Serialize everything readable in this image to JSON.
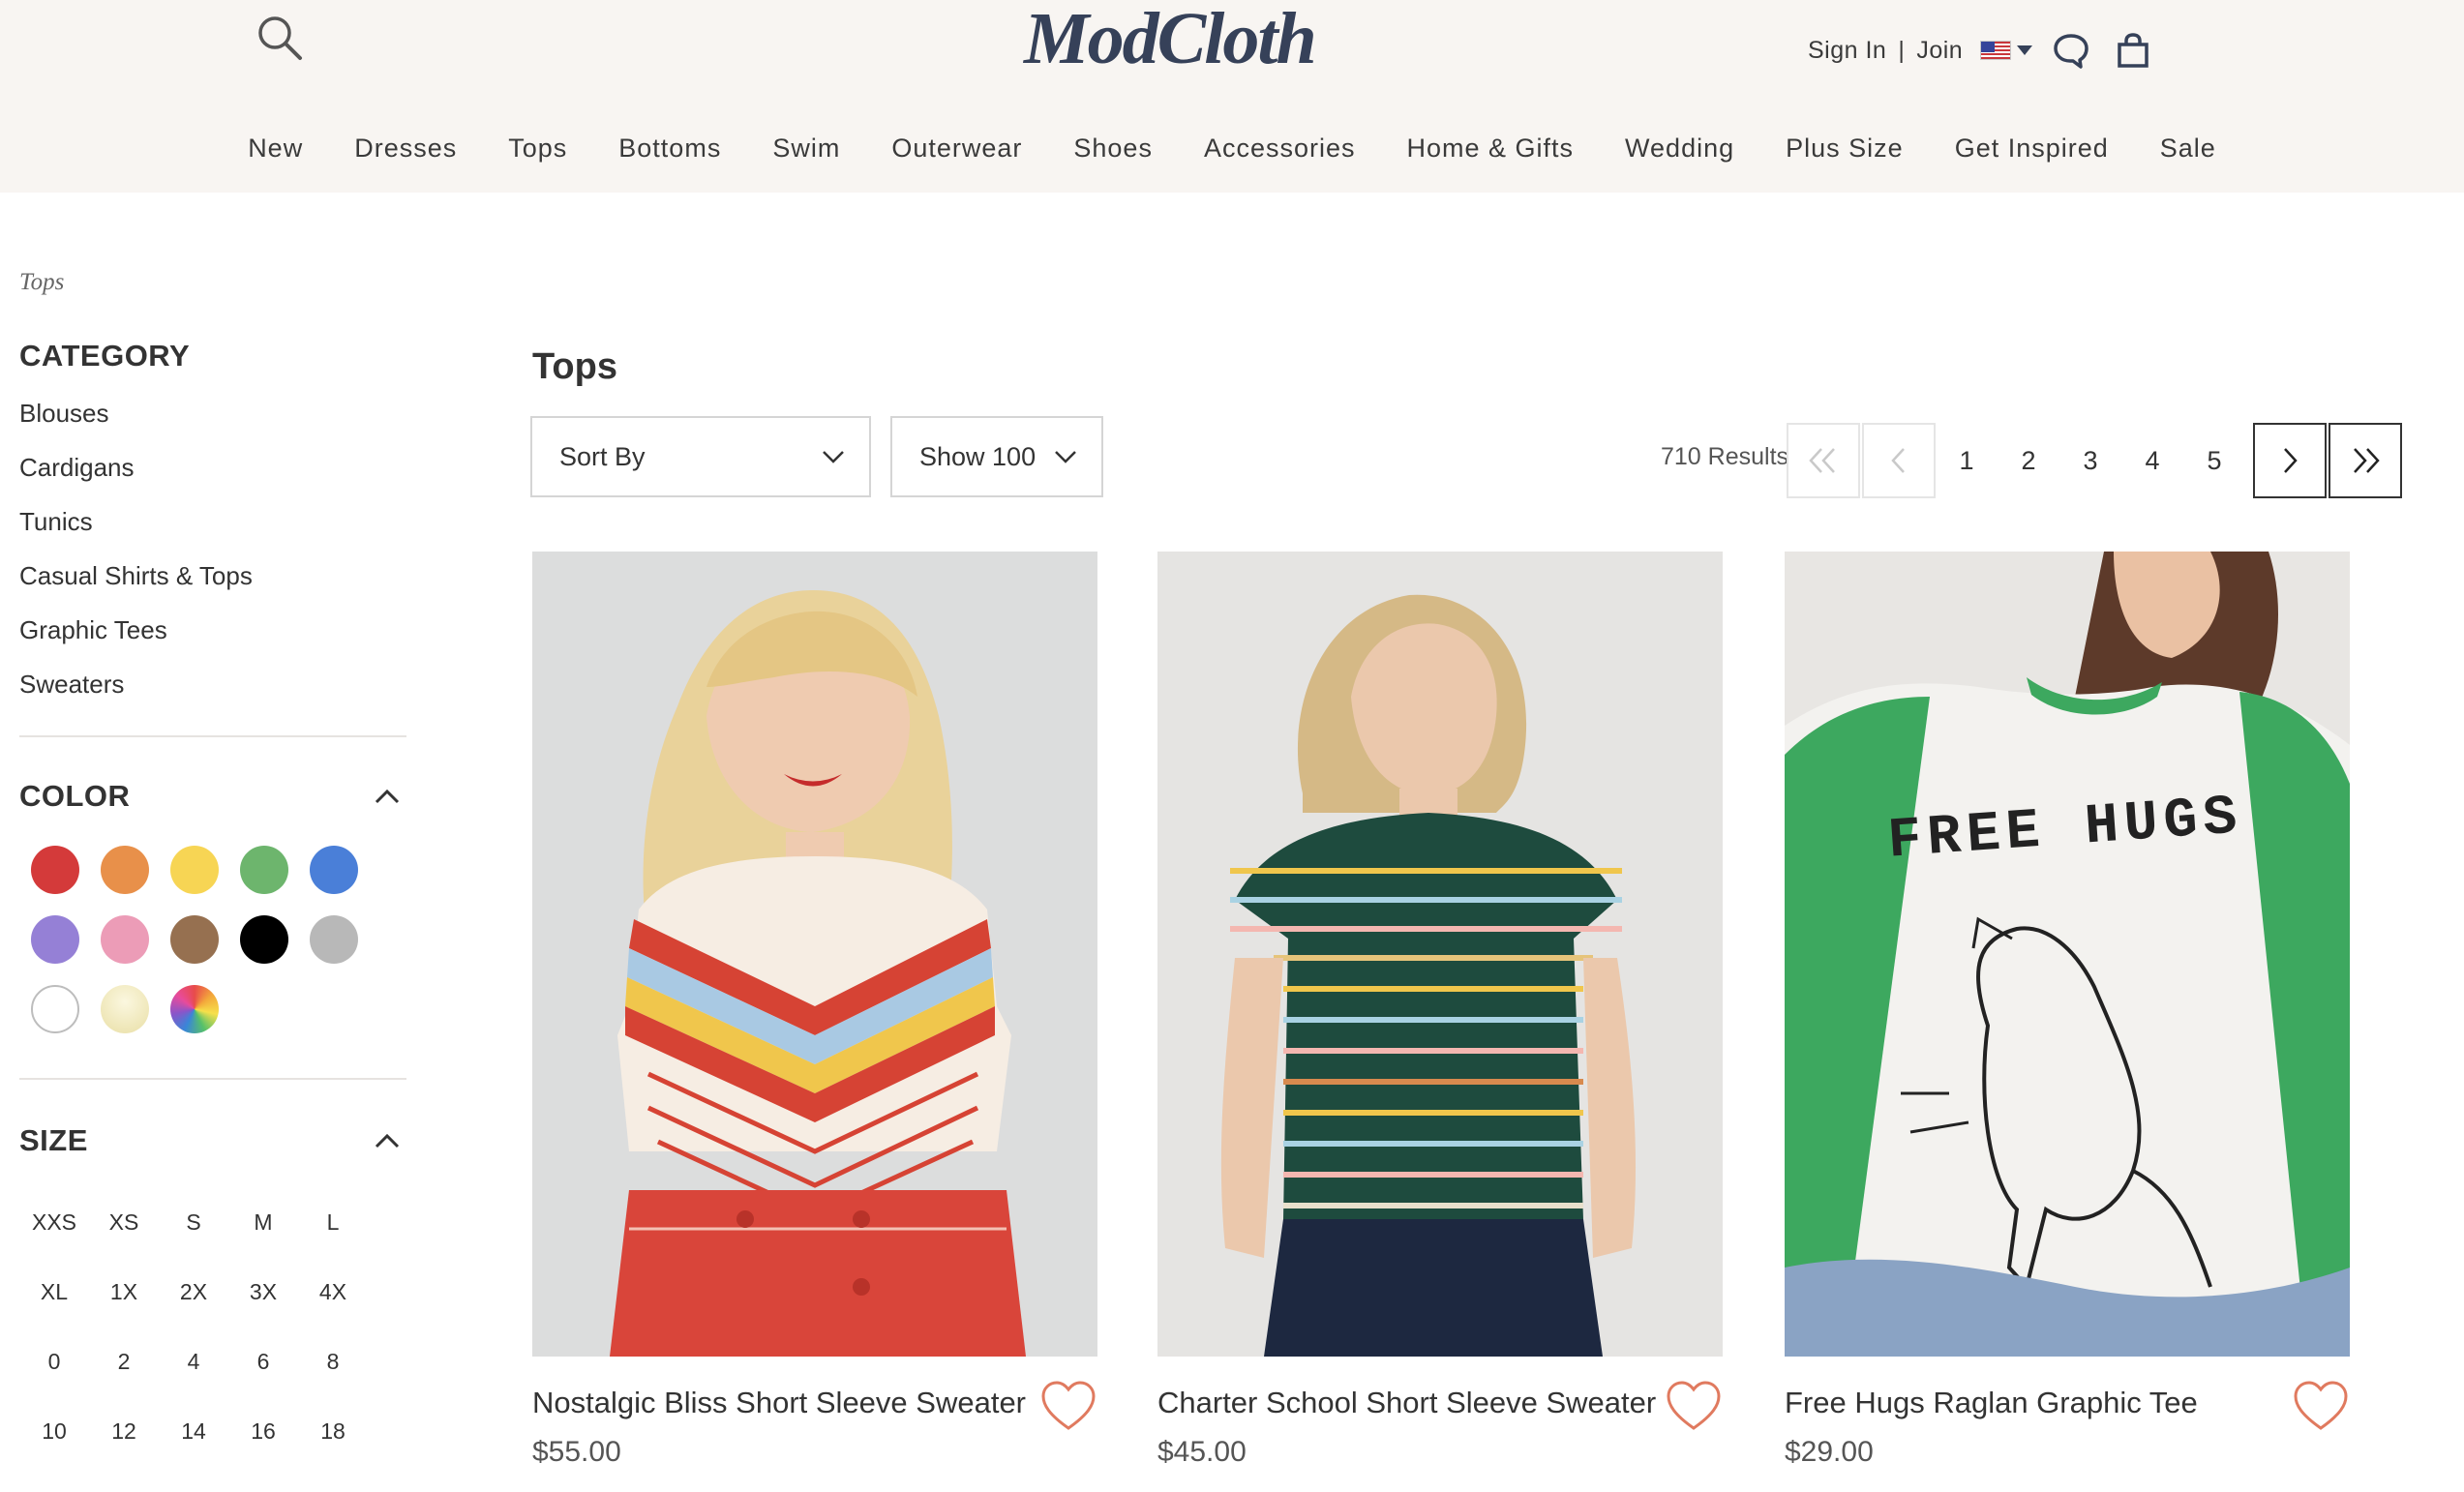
{
  "header": {
    "logo": "ModCloth",
    "sign_in": "Sign In",
    "separator": "|",
    "join": "Join"
  },
  "nav": [
    "New",
    "Dresses",
    "Tops",
    "Bottoms",
    "Swim",
    "Outerwear",
    "Shoes",
    "Accessories",
    "Home & Gifts",
    "Wedding",
    "Plus Size",
    "Get Inspired",
    "Sale"
  ],
  "breadcrumb": "Tops",
  "sidebar": {
    "category_title": "CATEGORY",
    "categories": [
      "Blouses",
      "Cardigans",
      "Tunics",
      "Casual Shirts & Tops",
      "Graphic Tees",
      "Sweaters"
    ],
    "color_title": "COLOR",
    "colors": [
      "#d43a3a",
      "#e8904a",
      "#f7d554",
      "#6db56d",
      "#4a7fd8",
      "#9580d6",
      "#ec9cb7",
      "#967050",
      "#000000",
      "#b8b8b8",
      "#ffffff",
      "#f2ebc3",
      "multicolor"
    ],
    "size_title": "SIZE",
    "sizes": [
      "XXS",
      "XS",
      "S",
      "M",
      "L",
      "XL",
      "1X",
      "2X",
      "3X",
      "4X",
      "0",
      "2",
      "4",
      "6",
      "8",
      "10",
      "12",
      "14",
      "16",
      "18"
    ]
  },
  "main": {
    "title": "Tops",
    "sort_label": "Sort By",
    "show_label": "Show 100",
    "results": "710 Results",
    "pages": [
      "1",
      "2",
      "3",
      "4",
      "5"
    ]
  },
  "products": [
    {
      "name": "Nostalgic Bliss Short Sleeve Sweater",
      "price": "$55.00"
    },
    {
      "name": "Charter School Short Sleeve Sweater",
      "price": "$45.00"
    },
    {
      "name": "Free Hugs Raglan Graphic Tee",
      "price": "$29.00"
    }
  ],
  "product3_print": {
    "line1": "FREE HUGS"
  },
  "accent_color": "#e07a5f",
  "brand_color": "#364159"
}
